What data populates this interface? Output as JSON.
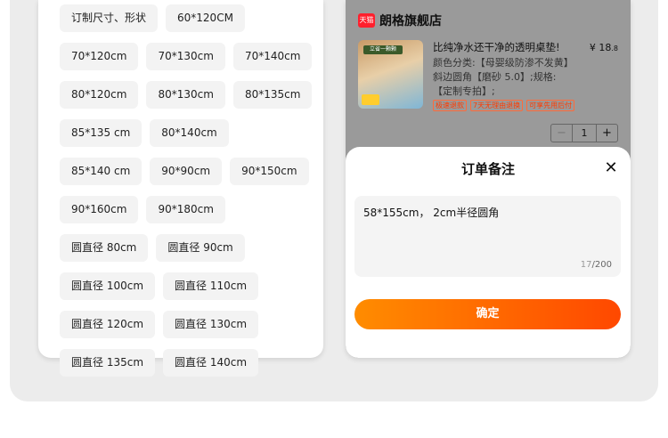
{
  "sizes": [
    "订制尺寸、形状",
    "60*120CM",
    "70*120cm",
    "70*130cm",
    "70*140cm",
    "80*120cm",
    "80*130cm",
    "80*135cm",
    "85*135 cm",
    "80*140cm",
    "85*140 cm",
    "90*90cm",
    "90*150cm",
    "90*160cm",
    "90*180cm",
    "圆直径 80cm",
    "圆直径 90cm",
    "圆直径 100cm",
    "圆直径 110cm",
    "圆直径 120cm",
    "圆直径 130cm",
    "圆直径 135cm",
    "圆直径 140cm"
  ],
  "shop": {
    "badge": "天猫",
    "name": "朗格旗舰店"
  },
  "product": {
    "title": "比纯净水还干净的透明桌垫!",
    "price_symbol": "¥",
    "price_int": "18",
    "price_dec": ".8",
    "desc": "颜色分类:【母婴级防渗不发黄】斜边圆角【磨砂 5.0】;规格:【定制专拍】;",
    "tags": [
      "极速退款",
      "7天无理由退换",
      "可享先用后付"
    ],
    "qty_minus": "−",
    "qty": "1",
    "qty_plus": "+",
    "thumb_text": "立省一颗颗"
  },
  "sheet": {
    "title": "订单备注",
    "close_icon": "close-icon",
    "note": "58*155cm， 2cm半径圆角",
    "count_current": "17",
    "count_max": "/200",
    "confirm": "确定"
  },
  "colors": {
    "accent_start": "#ff8c00",
    "accent_end": "#ff4800",
    "tmall_red": "#ff1f2d",
    "tag_orange": "#ff3a00"
  }
}
